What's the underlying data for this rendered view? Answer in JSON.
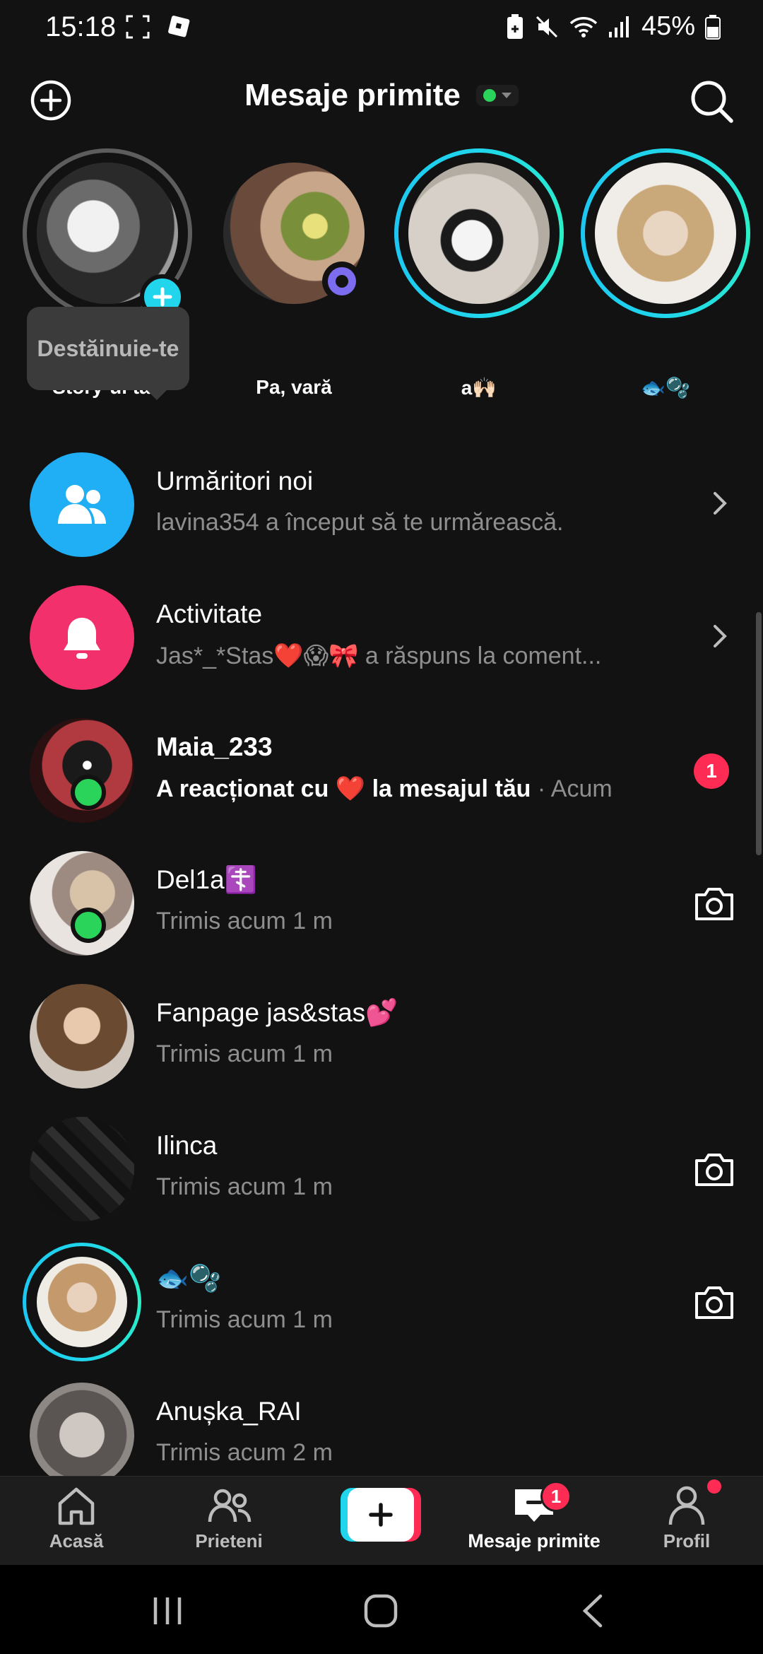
{
  "status_bar": {
    "time": "15:18",
    "battery": "45%"
  },
  "header": {
    "title": "Mesaje primite",
    "status_color": "#2ad45b"
  },
  "tooltip": {
    "text": "Destăinuie-te"
  },
  "stories": [
    {
      "label": "Story-ul tău",
      "ring": "seen",
      "has_add_button": true
    },
    {
      "label": "Pa, vară",
      "ring": "none",
      "has_badge": true
    },
    {
      "label": "a🙌🏻",
      "ring": "new"
    },
    {
      "label": "🐟🫧",
      "ring": "new"
    }
  ],
  "rows": [
    {
      "title": "Urmăritori noi",
      "subtitle": "lavina354 a început să te urmărească.",
      "icon": "followers-icon",
      "trailing": "chevron"
    },
    {
      "title": "Activitate",
      "subtitle": "Jas*_*Stas❤️😱🎀 a răspuns la coment...",
      "icon": "bell-icon",
      "trailing": "chevron"
    },
    {
      "title": "Maia_233",
      "subtitle": "A reacționat cu ❤️ la mesajul tău",
      "time": "· Acum",
      "unread": "1",
      "online": true,
      "trailing": "badge"
    },
    {
      "title": "Del1a☦️",
      "subtitle": "Trimis acum 1 m",
      "online": true,
      "trailing": "camera"
    },
    {
      "title": "Fanpage jas&stas💕",
      "subtitle": "Trimis acum 1 m",
      "trailing": "none"
    },
    {
      "title": "Ilinca",
      "subtitle": "Trimis acum 1 m",
      "trailing": "camera"
    },
    {
      "title": "🐟🫧",
      "subtitle": "Trimis acum 1 m",
      "story": true,
      "trailing": "camera"
    },
    {
      "title": "Anușka_RAI",
      "subtitle": "Trimis acum 2 m",
      "trailing": "none"
    }
  ],
  "bottom_nav": {
    "items": [
      {
        "label": "Acasă",
        "icon": "home-icon"
      },
      {
        "label": "Prieteni",
        "icon": "friends-icon"
      },
      {
        "label": "",
        "icon": "create-icon"
      },
      {
        "label": "Mesaje primite",
        "icon": "inbox-icon",
        "badge": "1",
        "active": true
      },
      {
        "label": "Profil",
        "icon": "profile-icon",
        "dot": true
      }
    ]
  },
  "colors": {
    "background": "#121212",
    "accent_cyan": "#20d5ec",
    "accent_pink": "#fe2c55",
    "online_green": "#2ad45b"
  }
}
